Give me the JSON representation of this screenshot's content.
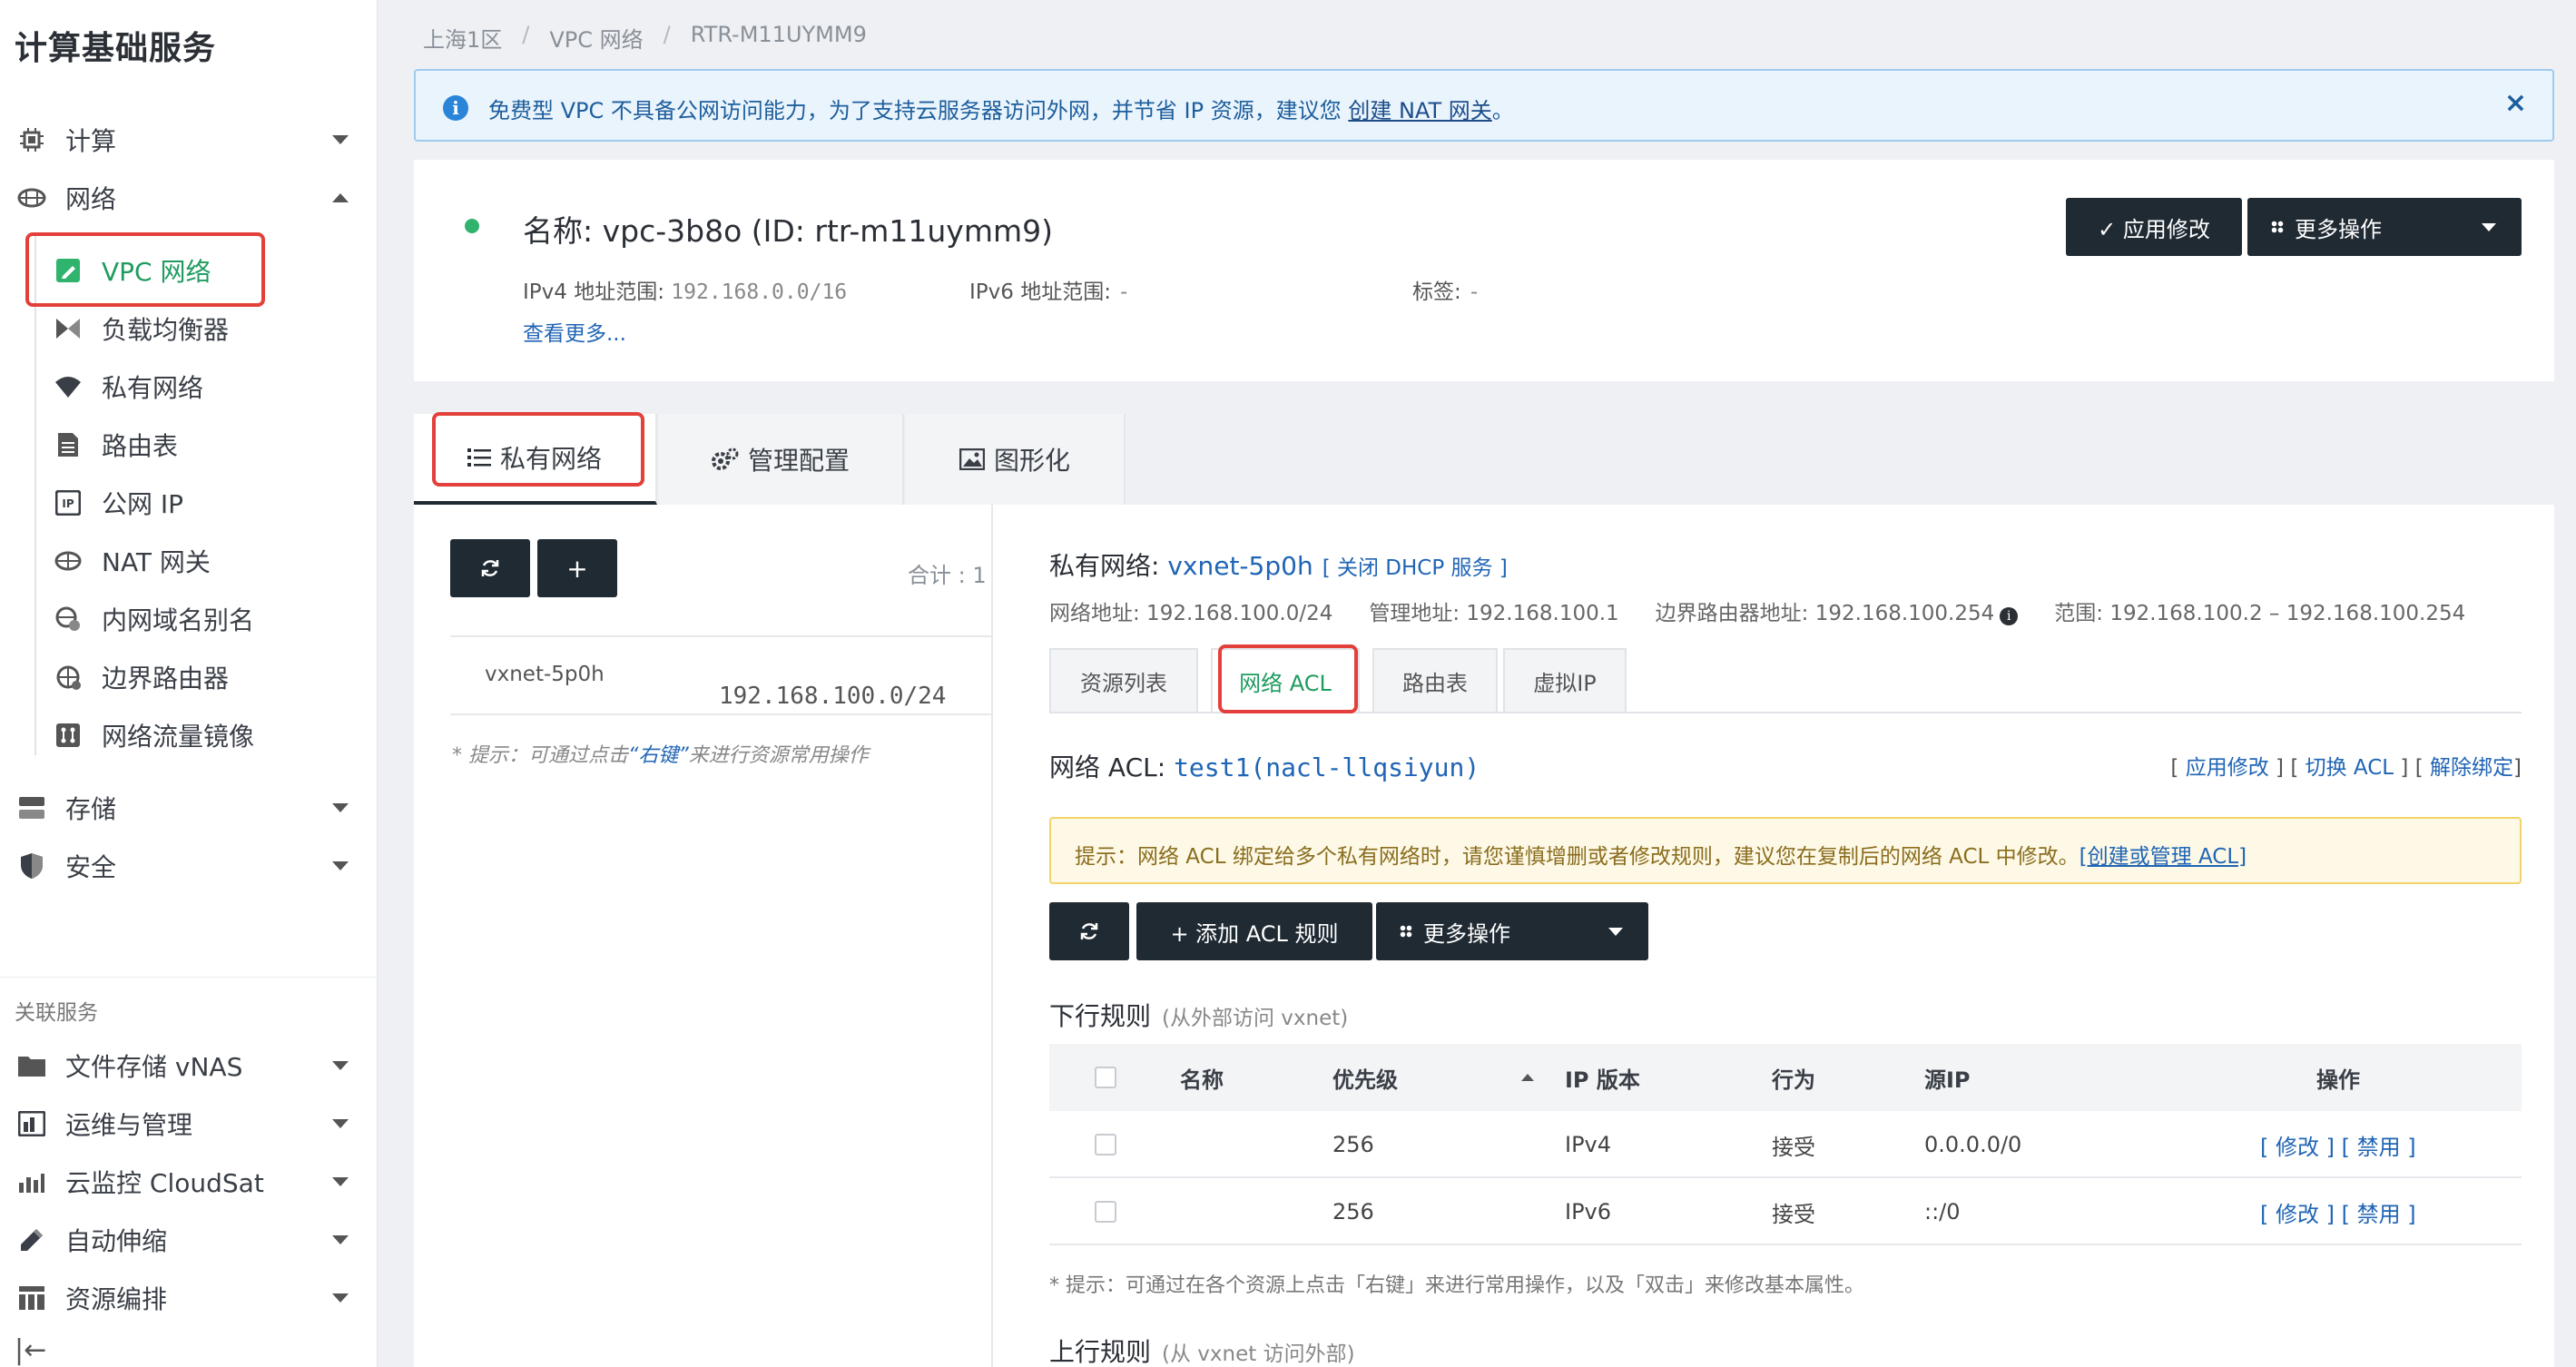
{
  "sidebar": {
    "title": "计算基础服务",
    "groups": [
      {
        "label": "计算",
        "icon": "chip-icon",
        "expanded": false
      },
      {
        "label": "网络",
        "icon": "network-icon",
        "expanded": true
      },
      {
        "label": "存储",
        "icon": "storage-icon",
        "expanded": false
      },
      {
        "label": "安全",
        "icon": "shield-icon",
        "expanded": false
      }
    ],
    "network_items": [
      {
        "label": "VPC 网络",
        "icon": "vpc-icon",
        "active": true
      },
      {
        "label": "负载均衡器",
        "icon": "load-balancer-icon"
      },
      {
        "label": "私有网络",
        "icon": "wifi-icon"
      },
      {
        "label": "路由表",
        "icon": "route-table-icon"
      },
      {
        "label": "公网 IP",
        "icon": "ip-icon"
      },
      {
        "label": "NAT 网关",
        "icon": "nat-icon"
      },
      {
        "label": "内网域名别名",
        "icon": "dns-icon"
      },
      {
        "label": "边界路由器",
        "icon": "border-router-icon"
      },
      {
        "label": "网络流量镜像",
        "icon": "mirror-icon"
      }
    ],
    "related_title": "关联服务",
    "related": [
      {
        "label": "文件存储 vNAS",
        "icon": "folder-icon"
      },
      {
        "label": "运维与管理",
        "icon": "ops-icon"
      },
      {
        "label": "云监控 CloudSat",
        "icon": "monitor-icon"
      },
      {
        "label": "自动伸缩",
        "icon": "autoscale-icon"
      },
      {
        "label": "资源编排",
        "icon": "orchestration-icon"
      }
    ],
    "collapse_glyph": "|←"
  },
  "breadcrumb": [
    "上海1区",
    "VPC 网络",
    "RTR-M11UYMM9"
  ],
  "notice": {
    "text": "免费型 VPC 不具备公网访问能力，为了支持云服务器访问外网，并节省 IP 资源，建议您 ",
    "link": "创建 NAT 网关",
    "suffix": "。",
    "close": "×"
  },
  "vpc": {
    "name": "名称: vpc-3b8o (ID: rtr-m11uymm9)",
    "ipv4_label": "IPv4 地址范围:",
    "ipv4_value": "192.168.0.0/16",
    "ipv6_label": "IPv6 地址范围:",
    "ipv6_value": "-",
    "tag_label": "标签:",
    "tag_value": "-",
    "see_more": "查看更多...",
    "apply_btn": "✓ 应用修改",
    "more_btn": "更多操作"
  },
  "tabs": [
    "私有网络",
    "管理配置",
    "图形化"
  ],
  "left_panel": {
    "total": "合计 : 1",
    "add": "+",
    "vxnet_name": "vxnet-5p0h",
    "vxnet_cidr": "192.168.100.0/24",
    "hint_prefix": "* 提示：可通过点击",
    "hint_key": "“右键”",
    "hint_suffix": "来进行资源常用操作"
  },
  "vxnet": {
    "title_label": "私有网络: ",
    "title_value": "vxnet-5p0h",
    "dhcp": "[ 关闭 DHCP 服务 ]",
    "meta": [
      "网络地址: 192.168.100.0/24",
      "管理地址: 192.168.100.1",
      "边界路由器地址: 192.168.100.254",
      "范围: 192.168.100.2 – 192.168.100.254"
    ],
    "info_glyph": "i",
    "subtabs": [
      "资源列表",
      "网络 ACL",
      "路由表",
      "虚拟IP"
    ]
  },
  "acl": {
    "title_label": "网络 ACL: ",
    "title_value": "test1(nacl-llqsiyun)",
    "links": [
      "应用修改",
      "切换 ACL",
      "解除绑定"
    ],
    "warning": "提示：网络 ACL 绑定给多个私有网络时，请您谨慎增删或者修改规则，建议您在复制后的网络 ACL 中修改。",
    "warning_link": "[创建或管理 ACL]",
    "add_btn": "+ 添加 ACL 规则",
    "more_btn": "更多操作",
    "down_title": "下行规则",
    "down_sub": "(从外部访问 vxnet)",
    "up_title": "上行规则",
    "up_sub": "(从 vxnet 访问外部)",
    "columns": [
      "名称",
      "优先级",
      "IP 版本",
      "行为",
      "源IP",
      "操作"
    ],
    "rows": [
      {
        "name": "",
        "priority": "256",
        "ip_version": "IPv4",
        "action": "接受",
        "source": "0.0.0.0/0",
        "ops": "[ 修改 ] [ 禁用 ]"
      },
      {
        "name": "",
        "priority": "256",
        "ip_version": "IPv6",
        "action": "接受",
        "source": "::/0",
        "ops": "[ 修改 ] [ 禁用 ]"
      }
    ],
    "table_hint": "* 提示：可通过在各个资源上点击「右键」来进行常用操作，以及「双击」来修改基本属性。"
  },
  "colors": {
    "accent_green": "#1f9c5f",
    "link_blue": "#2065b5",
    "dark_button": "#1f2a33",
    "highlight_red": "#e4403b"
  }
}
